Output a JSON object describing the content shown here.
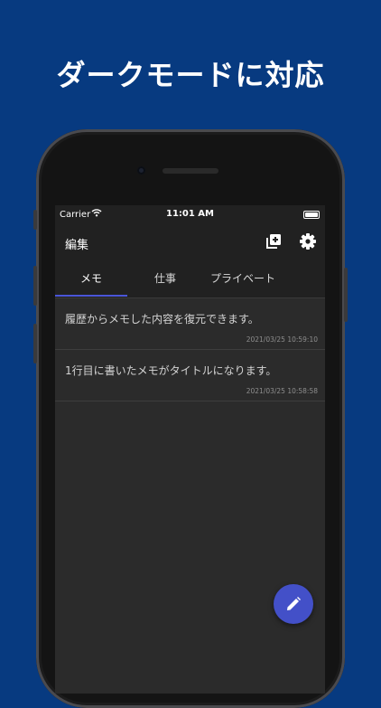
{
  "headline": "ダークモードに対応",
  "status_bar": {
    "carrier": "Carrier",
    "time": "11:01 AM"
  },
  "app_bar": {
    "edit_label": "編集",
    "icons": [
      "add-folder-icon",
      "gear-icon"
    ]
  },
  "tabs": [
    {
      "label": "メモ",
      "active": true
    },
    {
      "label": "仕事",
      "active": false
    },
    {
      "label": "プライベート",
      "active": false
    }
  ],
  "memos": [
    {
      "text": "履歴からメモした内容を復元できます。",
      "date": "2021/03/25 10:59:10"
    },
    {
      "text": "1行目に書いたメモがタイトルになります。",
      "date": "2021/03/25 10:58:58"
    }
  ],
  "fab": {
    "icon": "pencil-icon"
  },
  "colors": {
    "background": "#073a80",
    "accent": "#4350c8",
    "screen": "#2b2b2b",
    "bar": "#212121"
  }
}
